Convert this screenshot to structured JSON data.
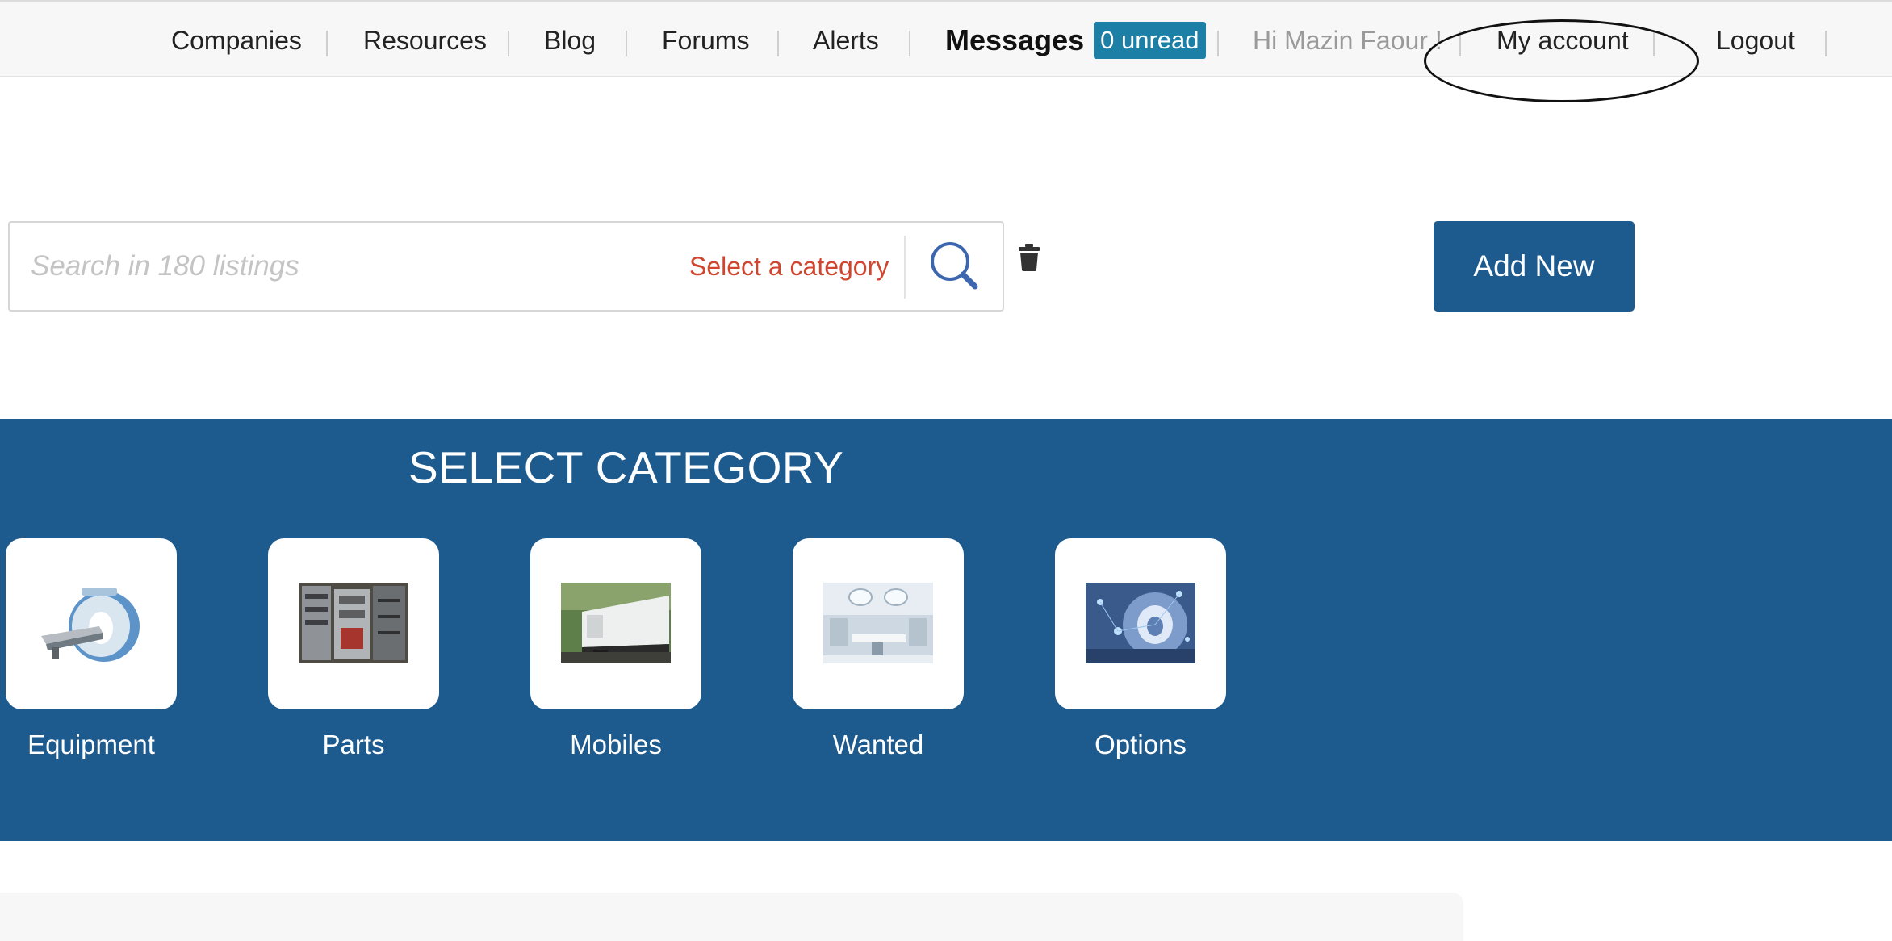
{
  "nav": {
    "companies": "Companies",
    "resources": "Resources",
    "blog": "Blog",
    "forums": "Forums",
    "alerts": "Alerts",
    "messages": "Messages",
    "unread": "0 unread",
    "greeting": "Hi Mazin Faour !",
    "my_account": "My account",
    "logout": "Logout"
  },
  "search": {
    "placeholder": "Search in 180 listings",
    "category_label": "Select a category",
    "search_icon": "search-icon",
    "trash_icon": "trash-icon"
  },
  "add_new": "Add New",
  "categories": {
    "title": "SELECT CATEGORY",
    "items": [
      {
        "label": "Equipment",
        "icon": "mri-scanner-image"
      },
      {
        "label": "Parts",
        "icon": "server-cabinet-image"
      },
      {
        "label": "Mobiles",
        "icon": "mobile-trailer-image"
      },
      {
        "label": "Wanted",
        "icon": "operating-room-image"
      },
      {
        "label": "Options",
        "icon": "tech-scanner-image"
      }
    ]
  },
  "colors": {
    "brand_blue": "#1d5a8e",
    "badge_teal": "#1b7fa6",
    "category_red": "#d0452e",
    "annotation_circle": "#111111"
  }
}
